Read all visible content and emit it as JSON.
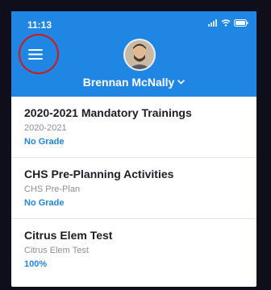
{
  "status_bar": {
    "time": "11:13",
    "icons": [
      "signal-icon",
      "wifi-icon",
      "battery-icon"
    ]
  },
  "header": {
    "menu_icon": "hamburger-menu-icon",
    "avatar_icon": "avatar-photo",
    "user_name": "Brennan McNally",
    "dropdown_icon": "chevron-down-icon"
  },
  "courses": [
    {
      "title": "2020-2021 Mandatory Trainings",
      "subtitle": "2020-2021",
      "grade": "No Grade"
    },
    {
      "title": "CHS Pre-Planning Activities",
      "subtitle": "CHS Pre-Plan",
      "grade": "No Grade"
    },
    {
      "title": "Citrus Elem Test",
      "subtitle": "Citrus Elem Test",
      "grade": "100%"
    }
  ],
  "colors": {
    "header_blue": "#1f86e3",
    "accent_blue": "#1f86e3",
    "annotation_red": "#d01a1a",
    "frame": "#0e0f1a"
  }
}
